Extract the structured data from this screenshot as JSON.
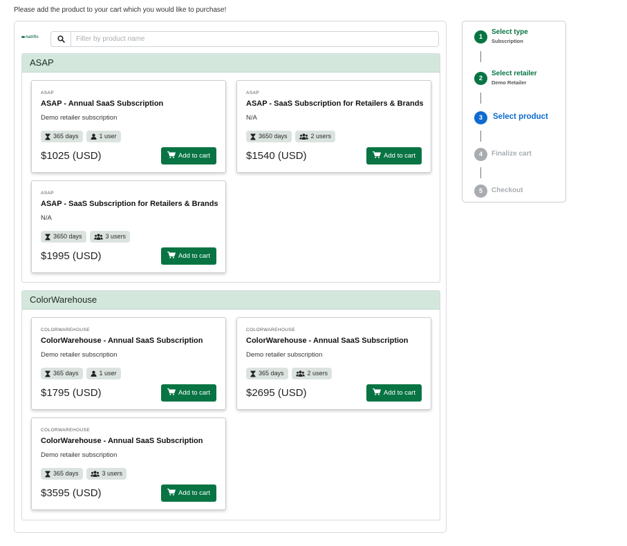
{
  "intro": "Please add the product to your cart which you would like to purchase!",
  "search": {
    "placeholder": "Filter by product name",
    "value": "",
    "logo_text": "natific"
  },
  "groups": [
    {
      "name": "ASAP",
      "cards": [
        {
          "brand": "ASAP",
          "title": "ASAP - Annual SaaS Subscription",
          "desc": "Demo retailer subscription",
          "duration": "365 days",
          "users": "1 user",
          "users_icon": "user-icon",
          "price": "$1025 (USD)",
          "button": "Add to cart"
        },
        {
          "brand": "ASAP",
          "title": "ASAP - SaaS Subscription for Retailers & Brands",
          "desc": "N/A",
          "duration": "3650 days",
          "users": "2 users",
          "users_icon": "users-icon",
          "price": "$1540 (USD)",
          "button": "Add to cart"
        },
        {
          "brand": "ASAP",
          "title": "ASAP - SaaS Subscription for Retailers & Brands",
          "desc": "N/A",
          "duration": "3650 days",
          "users": "3 users",
          "users_icon": "users-icon",
          "price": "$1995 (USD)",
          "button": "Add to cart"
        }
      ]
    },
    {
      "name": "ColorWarehouse",
      "cards": [
        {
          "brand": "COLORWAREHOUSE",
          "title": "ColorWarehouse - Annual SaaS Subscription",
          "desc": "Demo retailer subscription",
          "duration": "365 days",
          "users": "1 user",
          "users_icon": "user-icon",
          "price": "$1795 (USD)",
          "button": "Add to cart"
        },
        {
          "brand": "COLORWAREHOUSE",
          "title": "ColorWarehouse - Annual SaaS Subscription",
          "desc": "Demo retailer subscription",
          "duration": "365 days",
          "users": "2 users",
          "users_icon": "users-icon",
          "price": "$2695 (USD)",
          "button": "Add to cart"
        },
        {
          "brand": "COLORWAREHOUSE",
          "title": "ColorWarehouse - Annual SaaS Subscription",
          "desc": "Demo retailer subscription",
          "duration": "365 days",
          "users": "3 users",
          "users_icon": "users-icon",
          "price": "$3595 (USD)",
          "button": "Add to cart"
        }
      ]
    }
  ],
  "steps": [
    {
      "num": "1",
      "label": "Select type",
      "sub": "Subscription",
      "state": "done"
    },
    {
      "num": "2",
      "label": "Select retailer",
      "sub": "Demo Retailer",
      "state": "done"
    },
    {
      "num": "3",
      "label": "Select product",
      "sub": "",
      "state": "active"
    },
    {
      "num": "4",
      "label": "Finalize cart",
      "sub": "",
      "state": "pending"
    },
    {
      "num": "5",
      "label": "Checkout",
      "sub": "",
      "state": "pending"
    }
  ],
  "colors": {
    "done": "#087443",
    "active": "#0d6bd0",
    "pending": "#a8acb0",
    "button": "#087443",
    "group_header": "#d3e7dc"
  }
}
